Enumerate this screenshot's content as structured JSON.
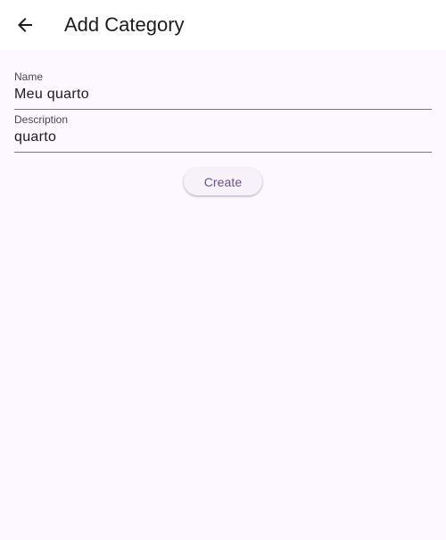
{
  "app_bar": {
    "title": "Add Category",
    "back_icon": "arrow-back-icon"
  },
  "form": {
    "name": {
      "label": "Name",
      "value": "Meu quarto"
    },
    "description": {
      "label": "Description",
      "value": "quarto"
    },
    "create_label": "Create"
  },
  "colors": {
    "background": "#fdf7ff",
    "app_bar": "#ffffff",
    "accent": "#65558f",
    "underline": "#7a757f"
  }
}
